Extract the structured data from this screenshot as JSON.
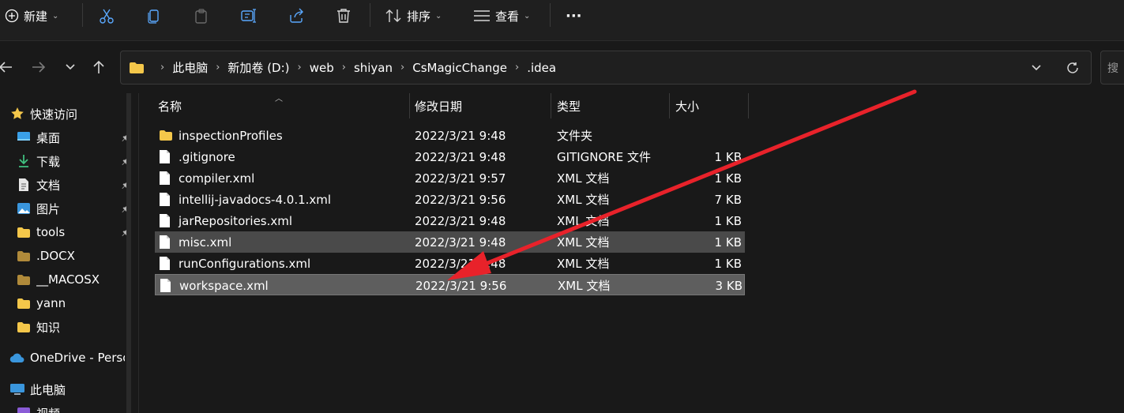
{
  "toolbar": {
    "new_label": "新建",
    "sort_label": "排序",
    "view_label": "查看",
    "more_label": "···"
  },
  "address": {
    "crumbs": [
      "此电脑",
      "新加卷 (D:)",
      "web",
      "shiyan",
      "CsMagicChange",
      ".idea"
    ],
    "search_placeholder": "搜"
  },
  "sidebar": {
    "quick_access": "快速访问",
    "items": [
      {
        "label": "桌面",
        "icon": "desktop-icon",
        "pinned": true
      },
      {
        "label": "下载",
        "icon": "download-icon",
        "pinned": true
      },
      {
        "label": "文档",
        "icon": "documents-icon",
        "pinned": true
      },
      {
        "label": "图片",
        "icon": "pictures-icon",
        "pinned": true
      },
      {
        "label": "tools",
        "icon": "folder-icon",
        "pinned": true
      },
      {
        "label": ".DOCX",
        "icon": "folder-icon",
        "pinned": false
      },
      {
        "label": "__MACOSX",
        "icon": "folder-icon",
        "pinned": false
      },
      {
        "label": "yann",
        "icon": "folder-icon",
        "pinned": false
      },
      {
        "label": "知识",
        "icon": "folder-icon",
        "pinned": false
      }
    ],
    "onedrive": "OneDrive - Perso",
    "this_pc": "此电脑",
    "videos": "视频"
  },
  "columns": {
    "name": "名称",
    "date": "修改日期",
    "type": "类型",
    "size": "大小"
  },
  "files": [
    {
      "name": "inspectionProfiles",
      "date": "2022/3/21 9:48",
      "type": "文件夹",
      "size": "",
      "kind": "folder",
      "state": ""
    },
    {
      "name": ".gitignore",
      "date": "2022/3/21 9:48",
      "type": "GITIGNORE 文件",
      "size": "1 KB",
      "kind": "file",
      "state": ""
    },
    {
      "name": "compiler.xml",
      "date": "2022/3/21 9:57",
      "type": "XML 文档",
      "size": "1 KB",
      "kind": "file",
      "state": ""
    },
    {
      "name": "intellij-javadocs-4.0.1.xml",
      "date": "2022/3/21 9:56",
      "type": "XML 文档",
      "size": "7 KB",
      "kind": "file",
      "state": ""
    },
    {
      "name": "jarRepositories.xml",
      "date": "2022/3/21 9:48",
      "type": "XML 文档",
      "size": "1 KB",
      "kind": "file",
      "state": ""
    },
    {
      "name": "misc.xml",
      "date": "2022/3/21 9:48",
      "type": "XML 文档",
      "size": "1 KB",
      "kind": "file",
      "state": "selected"
    },
    {
      "name": "runConfigurations.xml",
      "date": "2022/3/21 9:48",
      "type": "XML 文档",
      "size": "1 KB",
      "kind": "file",
      "state": ""
    },
    {
      "name": "workspace.xml",
      "date": "2022/3/21 9:56",
      "type": "XML 文档",
      "size": "3 KB",
      "kind": "file",
      "state": "focused"
    }
  ],
  "colors": {
    "annotation_arrow": "#e8222a",
    "folder": "#f4c74a",
    "selection": "#4a4a4a",
    "selection_focused": "#5e5e5e"
  }
}
